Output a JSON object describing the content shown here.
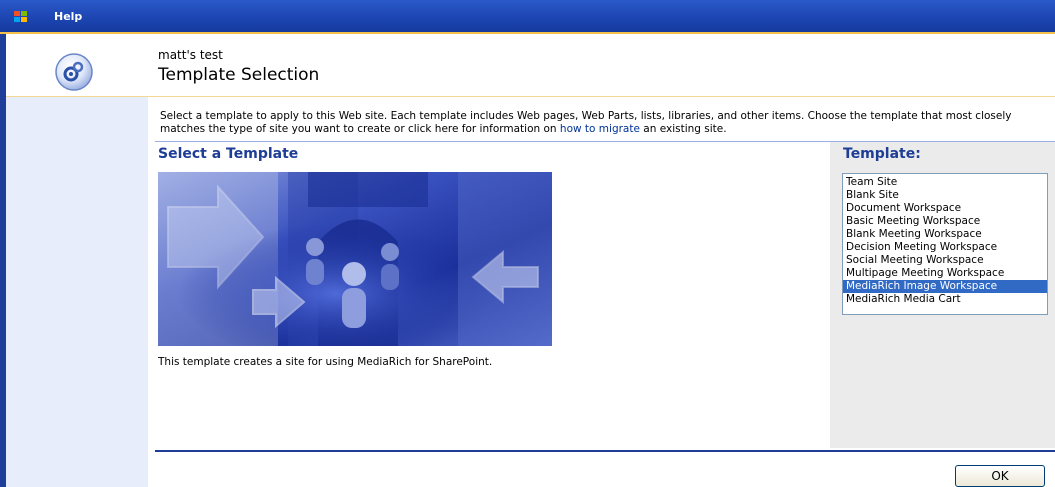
{
  "topbar": {
    "help_label": "Help"
  },
  "header": {
    "site_name": "matt's test",
    "page_title": "Template Selection"
  },
  "description": {
    "text_before_link": "Select a template to apply to this Web site. Each template includes Web pages, Web Parts, lists, libraries, and other items. Choose the template that most closely matches the type of site you want to create or click here for information on ",
    "link_text": "how to migrate",
    "text_after_link": " an existing site."
  },
  "main": {
    "select_heading": "Select a Template",
    "template_description": "This template creates a site for using MediaRich for SharePoint."
  },
  "template_list": {
    "heading": "Template:",
    "options": [
      "Team Site",
      "Blank Site",
      "Document Workspace",
      "Basic Meeting Workspace",
      "Blank Meeting Workspace",
      "Decision Meeting Workspace",
      "Social Meeting Workspace",
      "Multipage Meeting Workspace",
      "MediaRich Image Workspace",
      "MediaRich Media Cart"
    ],
    "selected_index": 8
  },
  "footer": {
    "ok_label": "OK"
  },
  "colors": {
    "topbar": "#1d46b3",
    "accent_gold": "#f4c04a",
    "heading_blue": "#1d3d96",
    "selection": "#316ac5",
    "left_panel": "#e7edfb"
  }
}
